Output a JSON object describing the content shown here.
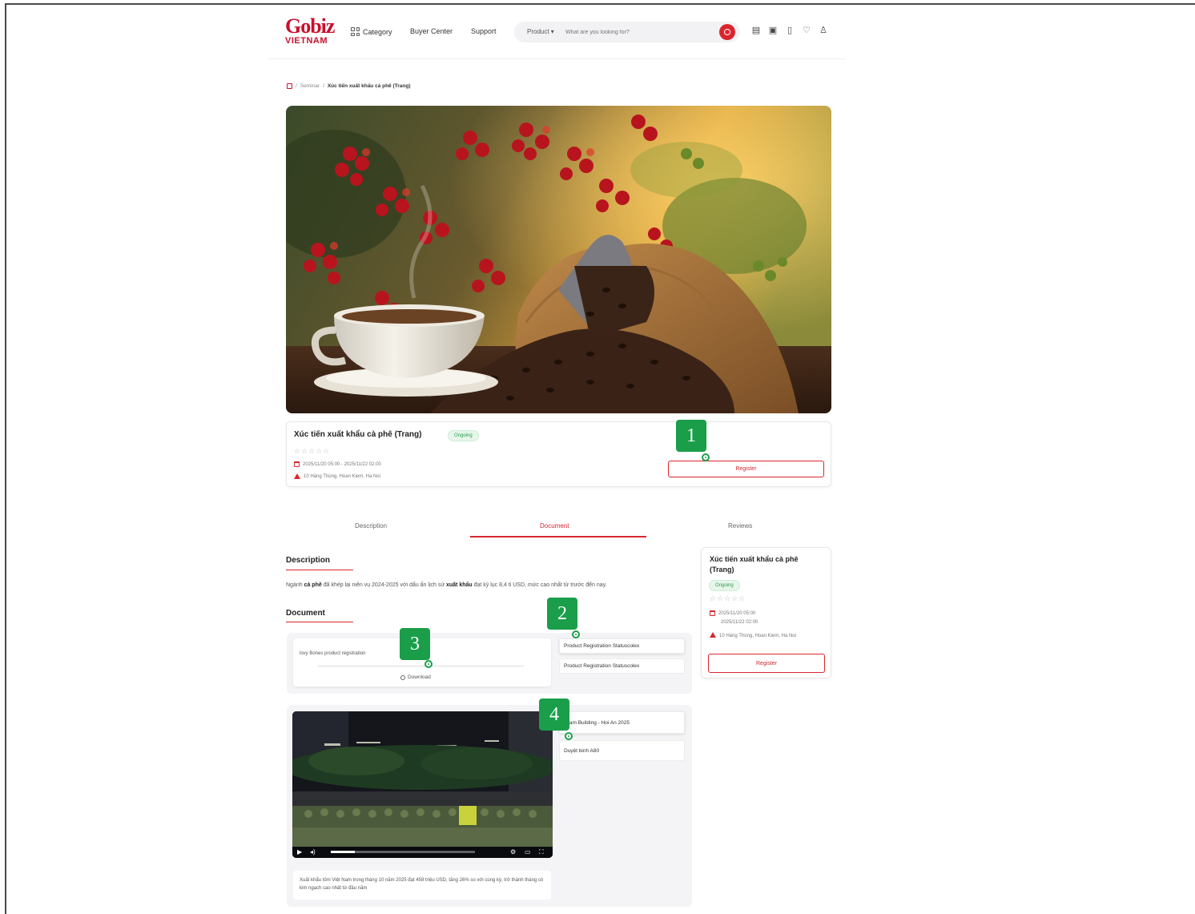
{
  "header": {
    "logo_main": "Gobiz",
    "logo_sub": "VIETNAM",
    "nav": [
      "Category",
      "Buyer Center",
      "Support"
    ],
    "search_category": "Product",
    "search_placeholder": "What are you looking for?"
  },
  "breadcrumb": {
    "items": [
      "Seminar",
      "Xúc tiến xuất khẩu cà phê (Trang)"
    ]
  },
  "event": {
    "title": "Xúc tiến xuất khẩu cà phê (Trang)",
    "status": "Ongoing",
    "rating": "☆☆☆☆☆",
    "datetime": "2025/11/20 05:00 - 2025/11/22 02:00",
    "location": "10 Hàng Thùng, Hoan Kiem, Ha Noi",
    "register_label": "Register"
  },
  "tabs": [
    "Description",
    "Document",
    "Reviews"
  ],
  "description": {
    "heading": "Description",
    "text_prefix": "Ngành ",
    "bold1": "cà phê",
    "text_mid": " đã khép lại niên vụ 2024-2025 với dấu ấn lịch sử ",
    "bold2": "xuất khẩu",
    "text_suffix": " đạt kỷ lục 8,4 tỉ USD, mức cao nhất từ trước đến nay."
  },
  "document": {
    "heading": "Document",
    "preview_text": "lovy Bones product registration",
    "download_label": "Download",
    "files": [
      "Product Registration Statuscolex",
      "Product Registration Statuscolex"
    ]
  },
  "videos": {
    "items": [
      "Team Building - Hoi An 2025",
      "Duyệt binh A80"
    ],
    "caption": "Xuất khẩu tôm Việt Nam trong tháng 10 năm 2025 đạt 458 triệu USD, tăng 26% so với cùng kỳ, trở thành tháng có kim ngạch cao nhất từ đầu năm"
  },
  "sidebar": {
    "title": "Xúc tiến xuất khẩu cà phê (Trang)",
    "status": "Ongoing",
    "rating": "☆☆☆☆☆",
    "date_start": "2025/11/20 05:00",
    "date_end": "2025/11/22 02:00",
    "location": "10 Hàng Thùng, Hoan Kiem, Ha Noi",
    "register_label": "Register"
  },
  "markers": [
    "1",
    "2",
    "3",
    "4"
  ],
  "colors": {
    "brand": "#c8102e",
    "accent": "#d9262e",
    "status_green": "#2c9a4b",
    "marker_green": "#1a9e4a"
  }
}
